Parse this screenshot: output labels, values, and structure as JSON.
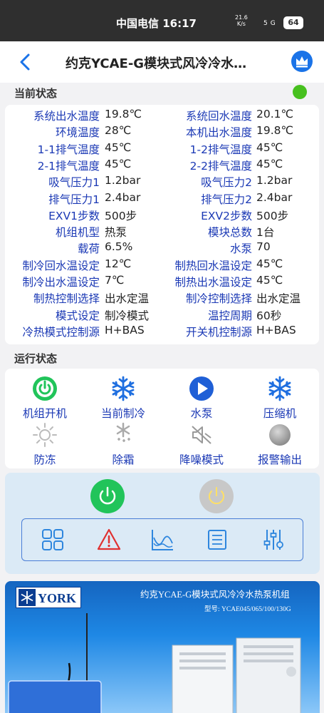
{
  "status_bar": {
    "carrier_time": "中国电信 16:17",
    "net_speed": "21.6",
    "net_unit": "K/s",
    "net_type": "5G",
    "battery": "64"
  },
  "header": {
    "title": "约克YCAE-G模块式风冷冷水…"
  },
  "current_status": {
    "title": "当前状态",
    "status_color": "#47c01f",
    "rows": [
      {
        "l1": "系统出水温度",
        "v1": "19.8℃",
        "l2": "系统回水温度",
        "v2": "20.1℃"
      },
      {
        "l1": "环境温度",
        "v1": "28℃",
        "l2": "本机出水温度",
        "v2": "19.8℃"
      },
      {
        "l1": "1-1排气温度",
        "v1": "45℃",
        "l2": "1-2排气温度",
        "v2": "45℃"
      },
      {
        "l1": "2-1排气温度",
        "v1": "45℃",
        "l2": "2-2排气温度",
        "v2": "45℃"
      },
      {
        "l1": "吸气压力1",
        "v1": "1.2bar",
        "l2": "吸气压力2",
        "v2": "1.2bar"
      },
      {
        "l1": "排气压力1",
        "v1": "2.4bar",
        "l2": "排气压力2",
        "v2": "2.4bar"
      },
      {
        "l1": "EXV1步数",
        "v1": "500步",
        "l2": "EXV2步数",
        "v2": "500步"
      },
      {
        "l1": "机组机型",
        "v1": "热泵",
        "l2": "模块总数",
        "v2": "1台"
      },
      {
        "l1": "载荷",
        "v1": "6.5%",
        "l2": "水泵",
        "v2": "70"
      },
      {
        "l1": "制冷回水温设定",
        "v1": "12℃",
        "l2": "制热回水温设定",
        "v2": "45℃"
      },
      {
        "l1": "制冷出水温设定",
        "v1": "7℃",
        "l2": "制热出水温设定",
        "v2": "45℃"
      },
      {
        "l1": "制热控制选择",
        "v1": "出水定温",
        "l2": "制冷控制选择",
        "v2": "出水定温"
      },
      {
        "l1": "模式设定",
        "v1": "制冷模式",
        "l2": "温控周期",
        "v2": "60秒"
      },
      {
        "l1": "冷热模式控制源",
        "v1": "H+BAS",
        "l2": "开关机控制源",
        "v2": "H+BAS"
      }
    ]
  },
  "run_status": {
    "title": "运行状态",
    "items": [
      {
        "label": "机组开机",
        "icon": "power-icon",
        "color": "#21c45a"
      },
      {
        "label": "当前制冷",
        "icon": "snowflake-icon",
        "color": "#1f6fe0"
      },
      {
        "label": "水泵",
        "icon": "play-icon",
        "color": "#1f5fd6"
      },
      {
        "label": "压缩机",
        "icon": "snowflake-icon",
        "color": "#1f6fe0"
      },
      {
        "label": "防冻",
        "icon": "sun-icon",
        "color": "#bbbbbb"
      },
      {
        "label": "除霜",
        "icon": "defrost-icon",
        "color": "#aaaaaa"
      },
      {
        "label": "降噪模式",
        "icon": "mute-icon",
        "color": "#999999"
      },
      {
        "label": "报警输出",
        "icon": "alarm-dot-icon",
        "color": "#8c8c8c"
      }
    ]
  },
  "controls": {
    "power_on_color": "#21c45a",
    "power_off_color": "#c8c8c8",
    "power_off_symbol_color": "#ffe066",
    "tools": [
      "grid-icon",
      "alert-icon",
      "curve-icon",
      "list-icon",
      "sliders-icon"
    ]
  },
  "banner": {
    "brand": "YORK",
    "title": "约克YCAE-G模块式风冷冷水热泵机组",
    "model": "型号: YCAE045/065/100/130G"
  }
}
